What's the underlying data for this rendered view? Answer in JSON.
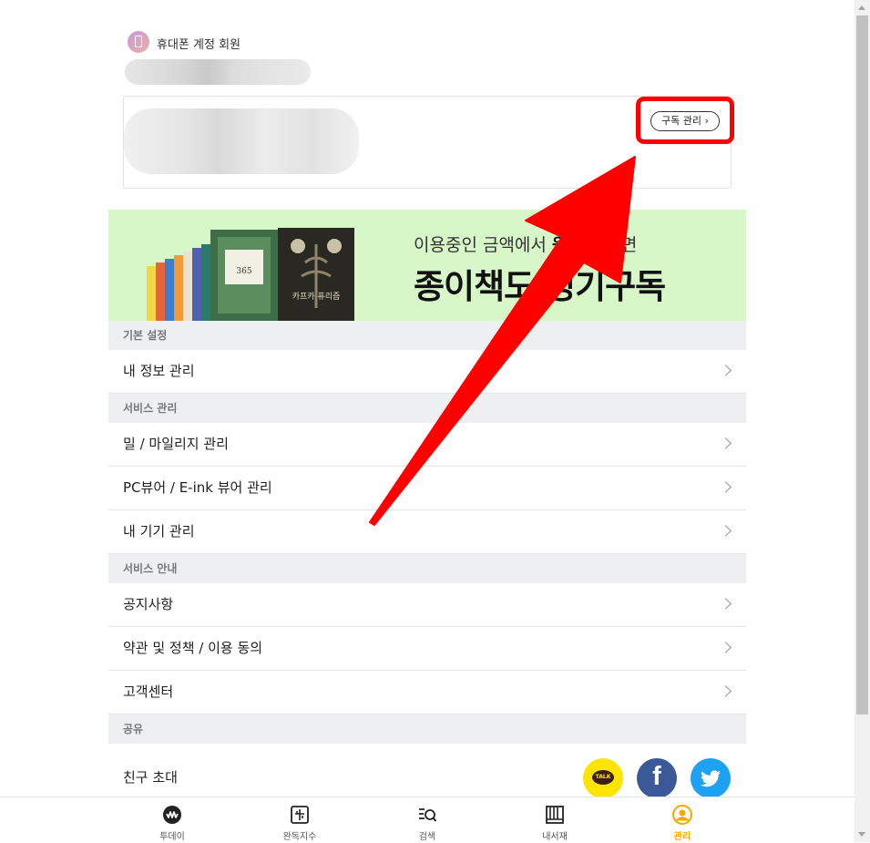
{
  "account": {
    "type_label": "휴대폰 계정 회원",
    "badge_icon": "phone-icon"
  },
  "subscription": {
    "manage_label": "구독 관리 ›"
  },
  "banner": {
    "text_normal_1": "이용중인 금액에서 ",
    "text_bold": "원",
    "text_normal_2": " 추가하면",
    "headline": "종이책도 정기구독",
    "book_title": "카프카 퓨리즘",
    "book_subtitle": "365",
    "bg_color": "#d7f7c8"
  },
  "sections": [
    {
      "header": "기본 설정",
      "items": [
        {
          "label": "내 정보 관리"
        }
      ]
    },
    {
      "header": "서비스 관리",
      "items": [
        {
          "label": "밀 / 마일리지 관리"
        },
        {
          "label": "PC뷰어 / E-ink 뷰어 관리"
        },
        {
          "label": "내 기기 관리"
        }
      ]
    },
    {
      "header": "서비스 안내",
      "items": [
        {
          "label": "공지사항"
        },
        {
          "label": "약관 및 정책 / 이용 동의"
        },
        {
          "label": "고객센터"
        }
      ]
    },
    {
      "header": "공유",
      "items": [
        {
          "label": "친구 초대"
        }
      ]
    }
  ],
  "share": {
    "kakao_label": "TALK",
    "facebook_label": "f",
    "icons": [
      "kakaotalk-icon",
      "facebook-icon",
      "twitter-icon"
    ]
  },
  "nav": {
    "items": [
      {
        "label": "투데이",
        "icon": "today-icon"
      },
      {
        "label": "완독지수",
        "icon": "completion-index-icon"
      },
      {
        "label": "검색",
        "icon": "search-icon"
      },
      {
        "label": "내서재",
        "icon": "library-icon"
      },
      {
        "label": "관리",
        "icon": "manage-icon"
      }
    ],
    "active_index": 4,
    "active_color": "#f5a800"
  },
  "annotation": {
    "highlight_color": "#ff0000"
  }
}
